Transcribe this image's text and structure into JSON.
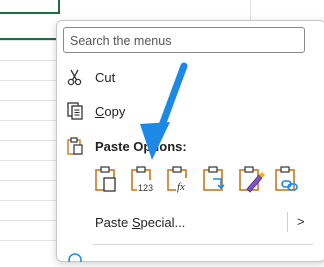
{
  "menu": {
    "search_placeholder": "Search the menus",
    "items": {
      "cut": {
        "label": "Cut",
        "icon": "scissors-icon"
      },
      "copy": {
        "label_first": "C",
        "label_rest": "opy",
        "icon": "copy-icon"
      },
      "paste_options": {
        "label": "Paste Options:",
        "icon": "clipboard-icon"
      },
      "paste_special": {
        "label_pre": "Paste ",
        "label_underlined": "S",
        "label_post": "pecial...",
        "submenu_glyph": ">"
      }
    },
    "paste_buttons": [
      {
        "name": "paste-icon",
        "sublabel": ""
      },
      {
        "name": "paste-values-icon",
        "sublabel": "123"
      },
      {
        "name": "paste-formulas-icon",
        "sublabel": "fx"
      },
      {
        "name": "paste-transpose-icon",
        "sublabel": ""
      },
      {
        "name": "paste-formatting-icon",
        "sublabel": ""
      },
      {
        "name": "paste-link-icon",
        "sublabel": ""
      }
    ]
  },
  "colors": {
    "accent_arrow": "#1e88e5",
    "clipboard_orange": "#c97a1a",
    "excel_green": "#1e6e43"
  }
}
